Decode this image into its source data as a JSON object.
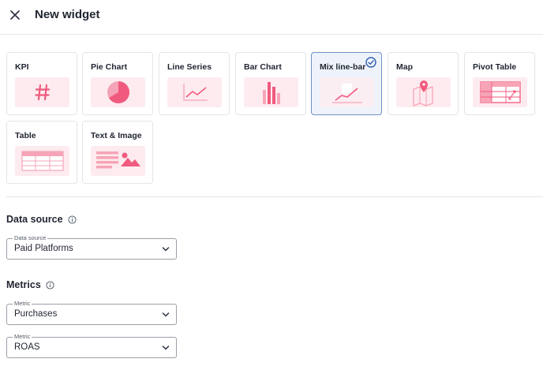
{
  "header": {
    "title": "New widget"
  },
  "widgets": [
    {
      "label": "KPI",
      "icon": "hash-icon"
    },
    {
      "label": "Pie Chart",
      "icon": "pie-chart-icon"
    },
    {
      "label": "Line Series",
      "icon": "line-chart-icon"
    },
    {
      "label": "Bar Chart",
      "icon": "bar-chart-icon"
    },
    {
      "label": "Mix line-bar",
      "icon": "mix-line-bar-icon",
      "selected": true
    },
    {
      "label": "Map",
      "icon": "map-icon"
    },
    {
      "label": "Pivot Table",
      "icon": "pivot-table-icon"
    },
    {
      "label": "Table",
      "icon": "table-icon"
    },
    {
      "label": "Text & Image",
      "icon": "text-image-icon"
    }
  ],
  "data_source": {
    "title": "Data source",
    "field_label": "Data source",
    "value": "Paid Platforms"
  },
  "metrics": {
    "title": "Metrics",
    "items": [
      {
        "label": "Metric",
        "value": "Purchases"
      },
      {
        "label": "Metric",
        "value": "ROAS"
      }
    ]
  },
  "colors": {
    "accent_pink": "#f05a7e",
    "thumb_bg": "#fdebef",
    "selected_border": "#6f8fca",
    "check_blue": "#2f5fb3"
  }
}
